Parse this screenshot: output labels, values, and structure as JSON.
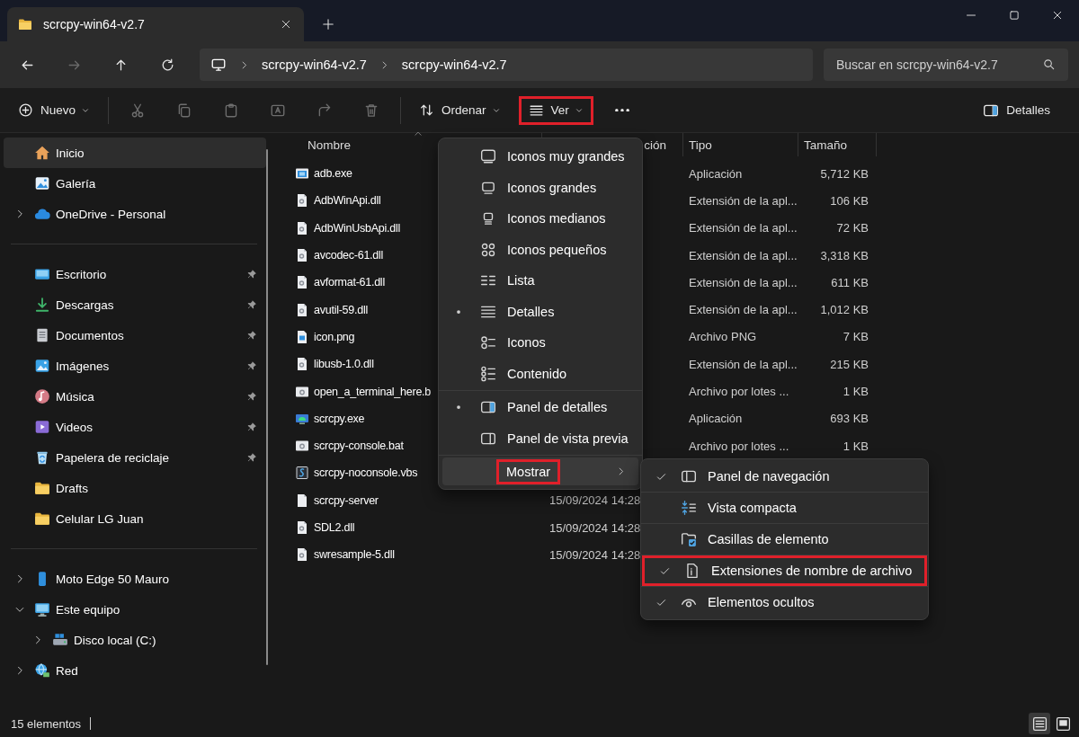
{
  "window": {
    "tab_title": "scrcpy-win64-v2.7"
  },
  "nav_buttons": [
    {
      "kind": "back",
      "disabled": false
    },
    {
      "kind": "forward",
      "disabled": true
    },
    {
      "kind": "up",
      "disabled": false
    },
    {
      "kind": "refresh",
      "disabled": false
    }
  ],
  "address_bar": {
    "breadcrumbs": [
      "scrcpy-win64-v2.7",
      "scrcpy-win64-v2.7"
    ]
  },
  "search": {
    "placeholder": "Buscar en scrcpy-win64-v2.7"
  },
  "toolbar": {
    "items": [
      {
        "kind": "new",
        "label": "Nuevo",
        "disabled": false,
        "highlighted": false
      },
      {
        "kind": "cut",
        "disabled": true,
        "highlighted": false
      },
      {
        "kind": "copy",
        "disabled": true,
        "highlighted": false
      },
      {
        "kind": "paste",
        "disabled": true,
        "highlighted": false
      },
      {
        "kind": "rename",
        "disabled": true,
        "highlighted": false
      },
      {
        "kind": "share",
        "disabled": true,
        "highlighted": false
      },
      {
        "kind": "delete",
        "disabled": true,
        "highlighted": false
      },
      {
        "kind": "sort",
        "label": "Ordenar",
        "disabled": false,
        "highlighted": false
      },
      {
        "kind": "view",
        "label": "Ver",
        "disabled": false,
        "highlighted": true
      },
      {
        "kind": "more",
        "disabled": false,
        "highlighted": false
      }
    ],
    "details": {
      "label": "Detalles"
    }
  },
  "sidebar": {
    "sections": [
      [
        {
          "kind": "home",
          "label": "Inicio",
          "selected": true,
          "pinned": false
        },
        {
          "kind": "gallery",
          "label": "Galería",
          "selected": false,
          "pinned": false
        },
        {
          "kind": "cloud",
          "label": "OneDrive - Personal",
          "selected": false,
          "pinned": false,
          "expanded": false
        }
      ],
      [
        {
          "kind": "desktop",
          "label": "Escritorio",
          "selected": false,
          "pinned": true
        },
        {
          "kind": "download",
          "label": "Descargas",
          "selected": false,
          "pinned": true
        },
        {
          "kind": "document",
          "label": "Documentos",
          "selected": false,
          "pinned": true
        },
        {
          "kind": "images",
          "label": "Imágenes",
          "selected": false,
          "pinned": true
        },
        {
          "kind": "music",
          "label": "Música",
          "selected": false,
          "pinned": true
        },
        {
          "kind": "videos",
          "label": "Videos",
          "selected": false,
          "pinned": true
        },
        {
          "kind": "recycle",
          "label": "Papelera de reciclaje",
          "selected": false,
          "pinned": true
        },
        {
          "kind": "folder",
          "label": "Drafts",
          "selected": false,
          "pinned": false
        },
        {
          "kind": "folder",
          "label": "Celular LG Juan",
          "selected": false,
          "pinned": false
        }
      ],
      [
        {
          "kind": "phone",
          "label": "Moto Edge 50 Mauro",
          "selected": false,
          "pinned": false,
          "expanded": false
        },
        {
          "kind": "computer",
          "label": "Este equipo",
          "selected": false,
          "pinned": false,
          "expanded": true,
          "children": [
            {
              "kind": "drive",
              "label": "Disco local (C:)",
              "selected": false,
              "pinned": false,
              "expanded": false
            }
          ]
        },
        {
          "kind": "network",
          "label": "Red",
          "selected": false,
          "pinned": false,
          "expanded": false
        }
      ]
    ]
  },
  "file_list": {
    "columns": [
      {
        "label": "Nombre",
        "sorted": true
      },
      {
        "label": "ción",
        "sorted": false
      },
      {
        "label": "Tipo",
        "sorted": false
      },
      {
        "label": "Tamaño",
        "sorted": false
      }
    ],
    "rows": [
      {
        "kind": "exe",
        "name": "adb.exe",
        "type": "Aplicación",
        "size": "5,712 KB"
      },
      {
        "kind": "dll",
        "name": "AdbWinApi.dll",
        "type": "Extensión de la apl...",
        "size": "106 KB"
      },
      {
        "kind": "dll",
        "name": "AdbWinUsbApi.dll",
        "type": "Extensión de la apl...",
        "size": "72 KB"
      },
      {
        "kind": "dll",
        "name": "avcodec-61.dll",
        "type": "Extensión de la apl...",
        "size": "3,318 KB"
      },
      {
        "kind": "dll",
        "name": "avformat-61.dll",
        "type": "Extensión de la apl...",
        "size": "611 KB"
      },
      {
        "kind": "dll",
        "name": "avutil-59.dll",
        "type": "Extensión de la apl...",
        "size": "1,012 KB"
      },
      {
        "kind": "png",
        "name": "icon.png",
        "type": "Archivo PNG",
        "size": "7 KB"
      },
      {
        "kind": "dll",
        "name": "libusb-1.0.dll",
        "type": "Extensión de la apl...",
        "size": "215 KB"
      },
      {
        "kind": "bat",
        "name": "open_a_terminal_here.b",
        "type": "Archivo por lotes ...",
        "size": "1 KB"
      },
      {
        "kind": "app",
        "name": "scrcpy.exe",
        "type": "Aplicación",
        "size": "693 KB"
      },
      {
        "kind": "bat",
        "name": "scrcpy-console.bat",
        "type": "Archivo por lotes ...",
        "size": "1 KB"
      },
      {
        "kind": "vbs",
        "name": "scrcpy-noconsole.vbs"
      },
      {
        "kind": "blank",
        "name": "scrcpy-server",
        "date": "15/09/2024 14:28"
      },
      {
        "kind": "dll",
        "name": "SDL2.dll",
        "date": "15/09/2024 14:28"
      },
      {
        "kind": "dll",
        "name": "swresample-5.dll",
        "date": "15/09/2024 14:28"
      }
    ]
  },
  "view_menu": {
    "groups": [
      [
        {
          "kind": "xl",
          "label": "Iconos muy grandes",
          "selected": false
        },
        {
          "kind": "lg",
          "label": "Iconos grandes",
          "selected": false
        },
        {
          "kind": "md",
          "label": "Iconos medianos",
          "selected": false
        },
        {
          "kind": "sm",
          "label": "Iconos pequeños",
          "selected": false
        },
        {
          "kind": "list",
          "label": "Lista",
          "selected": false
        },
        {
          "kind": "details",
          "label": "Detalles",
          "selected": true
        },
        {
          "kind": "tiles",
          "label": "Iconos",
          "selected": false
        },
        {
          "kind": "content",
          "label": "Contenido",
          "selected": false
        }
      ],
      [
        {
          "kind": "details-pane",
          "label": "Panel de detalles",
          "selected": true
        },
        {
          "kind": "preview-pane",
          "label": "Panel de vista previa",
          "selected": false
        }
      ]
    ],
    "show": {
      "label": "Mostrar",
      "highlighted": true
    }
  },
  "show_submenu": {
    "items": [
      {
        "kind": "nav-pane",
        "label": "Panel de navegación",
        "checked": true,
        "highlighted": false
      },
      {
        "kind": "compact",
        "label": "Vista compacta",
        "checked": false,
        "highlighted": false
      },
      {
        "kind": "checkboxes",
        "label": "Casillas de elemento",
        "checked": false,
        "highlighted": false
      },
      {
        "kind": "extensions",
        "label": "Extensiones de nombre de archivo",
        "checked": true,
        "highlighted": true
      },
      {
        "kind": "hidden",
        "label": "Elementos ocultos",
        "checked": true,
        "highlighted": false
      }
    ]
  },
  "status_bar": {
    "count": "15 elementos",
    "views": [
      {
        "kind": "details",
        "selected": true
      },
      {
        "kind": "tiles",
        "selected": false
      }
    ]
  }
}
